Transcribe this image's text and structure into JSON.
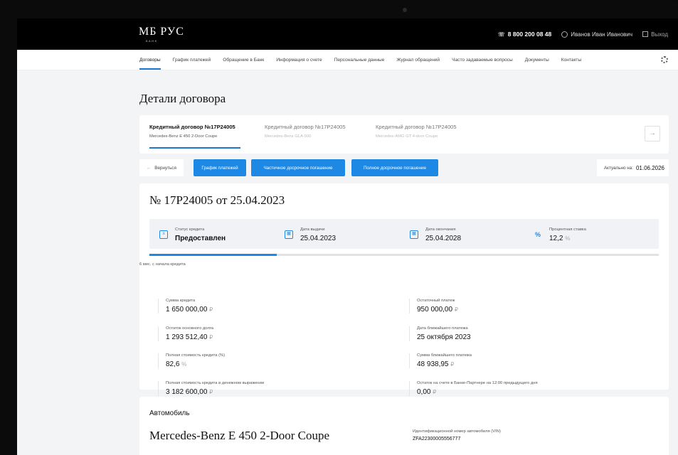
{
  "header": {
    "logo": "МБ РУС",
    "logo_sub": "БАНК",
    "phone": "8 800 200 08 48",
    "user": "Иванов Иван Иванович",
    "logout": "Выход"
  },
  "nav": {
    "items": [
      {
        "label": "Договоры",
        "active": true
      },
      {
        "label": "График платежей"
      },
      {
        "label": "Обращение в Банк"
      },
      {
        "label": "Информация о счете"
      },
      {
        "label": "Персональные данные"
      },
      {
        "label": "Журнал обращений"
      },
      {
        "label": "Часто задаваемые вопросы"
      },
      {
        "label": "Документы"
      },
      {
        "label": "Контакты"
      }
    ],
    "settings_icon": "gear-icon"
  },
  "page": {
    "title": "Детали договора"
  },
  "contracts": [
    {
      "title": "Кредитный договор №17P24005",
      "sub": "Mercedes-Benz E 450 2-Door Coupe",
      "active": true
    },
    {
      "title": "Кредитный договор №17P24005",
      "sub": "Mercedes-Benz GLA-500"
    },
    {
      "title": "Кредитный договор №17P24005",
      "sub": "Mercedes-AMG GT 4-door Coupe"
    }
  ],
  "actions": {
    "back": "Вернуться",
    "schedule": "График платежей",
    "partial": "Частичное досрочное погашение",
    "full": "Полное досрочное погашение",
    "actual_label": "Актуально на:",
    "actual_date": "01.06.2026"
  },
  "contract": {
    "title": "№ 17P24005 от 25.04.2023",
    "status_label": "Статус кредита",
    "status_value": "Предоставлен",
    "issue_label": "Дата выдачи",
    "issue_value": "25.04.2023",
    "end_label": "Дата окончания",
    "end_value": "25.04.2028",
    "rate_label": "Процентная ставка",
    "rate_value": "12,2",
    "rate_unit": "%",
    "progress_fraction": 0.25,
    "progress_caption": "6 мес. с начала кредита",
    "currency": "₽",
    "left": [
      {
        "k": "Сумма кредита",
        "v": "1 650 000,00",
        "u": "₽"
      },
      {
        "k": "Остаток основного долга",
        "v": "1 293 512,40",
        "u": "₽"
      },
      {
        "k": "Полная стоимость кредита (%)",
        "v": "82,6",
        "u": "%"
      },
      {
        "k": "Полная стоимость кредита в денежном выражении",
        "v": "3 182 600,00",
        "u": "₽"
      }
    ],
    "right": [
      {
        "k": "Остаточный платеж",
        "v": "950 000,00",
        "u": "₽"
      },
      {
        "k": "Дата ближайшего платежа",
        "v": "25 октября 2023",
        "u": ""
      },
      {
        "k": "Сумма ближайшего платежа",
        "v": "48 938,95",
        "u": "₽"
      },
      {
        "k": "Остаток на счете в Банке-Партнере на 12:00 предыдущего дня",
        "v": "0,00",
        "u": "₽"
      }
    ]
  },
  "auto": {
    "heading": "Автомобиль",
    "model": "Mercedes-Benz E 450 2-Door Coupe",
    "vin_label": "Идентификационной номер автомобиля (VIN)",
    "vin_value": "ZFA22300005556777"
  }
}
